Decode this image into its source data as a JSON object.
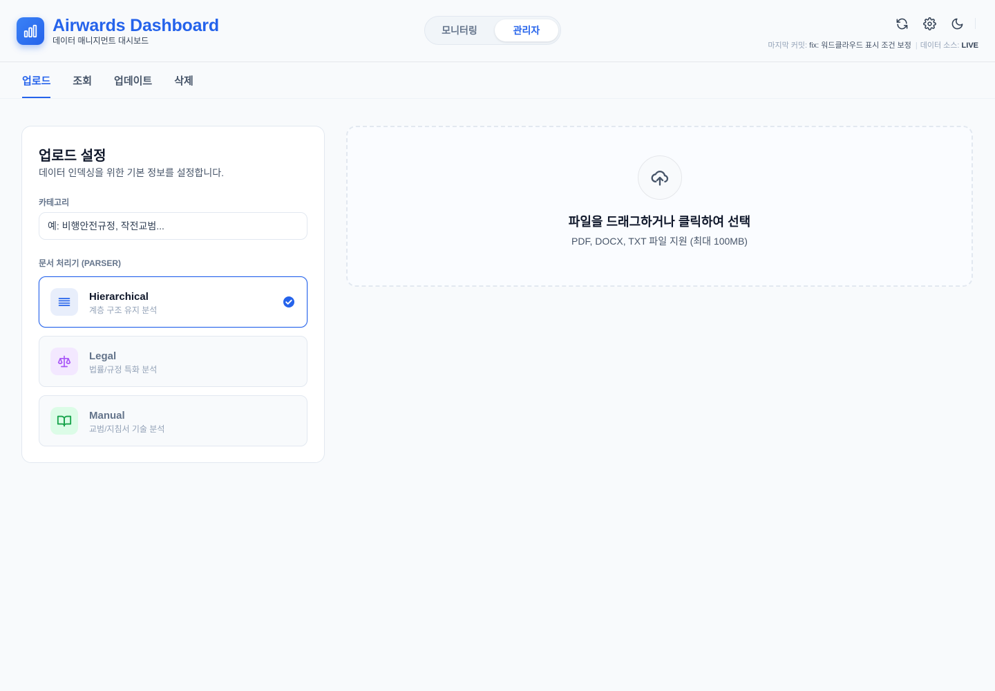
{
  "app": {
    "title": "Airwards Dashboard",
    "subtitle": "데이터 매니지먼트 대시보드"
  },
  "mode_toggle": {
    "monitoring": "모니터링",
    "admin": "관리자",
    "selected": "관리자"
  },
  "header_icons": [
    "refresh-icon",
    "gear-icon",
    "moon-icon"
  ],
  "status": {
    "commit_label": "마지막 커밋:",
    "commit_value": "fix: 워드클라우드 표시 조건 보정",
    "source_label": "데이터 소스:",
    "source_value": "LIVE"
  },
  "tabs": [
    {
      "label": "업로드",
      "active": true
    },
    {
      "label": "조회",
      "active": false
    },
    {
      "label": "업데이트",
      "active": false
    },
    {
      "label": "삭제",
      "active": false
    }
  ],
  "settings": {
    "title": "업로드 설정",
    "subtitle": "데이터 인덱싱을 위한 기본 정보를 설정합니다.",
    "category_label": "카테고리",
    "category_placeholder": "예: 비행안전규정, 작전교범...",
    "category_value": "",
    "parser_label": "문서 처리기 (PARSER)",
    "parsers": [
      {
        "name": "Hierarchical",
        "desc": "계층 구조 유지 분석",
        "icon": "list-icon",
        "selected": true
      },
      {
        "name": "Legal",
        "desc": "법률/규정 특화 분석",
        "icon": "scale-icon",
        "selected": false
      },
      {
        "name": "Manual",
        "desc": "교범/지침서 기술 분석",
        "icon": "book-icon",
        "selected": false
      }
    ]
  },
  "dropzone": {
    "title": "파일을 드래그하거나 클릭하여 선택",
    "subtitle": "PDF, DOCX, TXT 파일 지원 (최대 100MB)",
    "icon": "cloud-upload-icon"
  },
  "colors": {
    "accent": "#2563eb",
    "legal": "#a855f7",
    "manual": "#16a34a"
  }
}
